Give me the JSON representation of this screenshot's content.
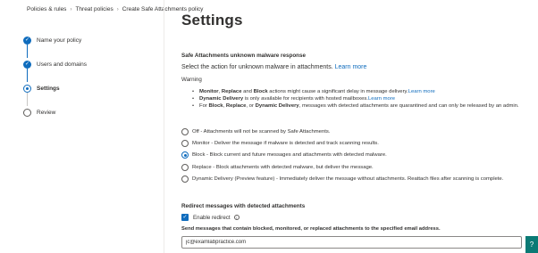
{
  "breadcrumb": [
    "Policies & rules",
    "Threat policies",
    "Create Safe Attachments policy"
  ],
  "wizard": {
    "steps": [
      {
        "label": "Name your policy",
        "state": "done"
      },
      {
        "label": "Users and domains",
        "state": "done"
      },
      {
        "label": "Settings",
        "state": "current"
      },
      {
        "label": "Review",
        "state": "todo"
      }
    ]
  },
  "page": {
    "title": "Settings",
    "unknown_section_title": "Safe Attachments unknown malware response",
    "unknown_section_desc": "Select the action for unknown malware in attachments.",
    "learn_more": "Learn more",
    "warning_label": "Warning",
    "warnings": [
      {
        "bold1": "Monitor",
        "t1": ", ",
        "bold2": "Replace",
        "t2": " and ",
        "bold3": "Block",
        "t3": " actions might cause a significant delay in message delivery.",
        "link": "Learn more"
      },
      {
        "bold1": "Dynamic Delivery",
        "t1": " is only available for recipients with hosted mailboxes.",
        "bold2": "",
        "t2": "",
        "bold3": "",
        "t3": "",
        "link": "Learn more"
      },
      {
        "bold1": "",
        "t1": "For ",
        "bold2": "Block",
        "t2": ", ",
        "bold3": "Replace",
        "t3": ", or ",
        "bold4": "Dynamic Delivery",
        "t4": ", messages with detected attachments are quarantined and can only be released by an admin.",
        "link": ""
      }
    ],
    "options": [
      {
        "label": "Off - Attachments will not be scanned by Safe Attachments.",
        "selected": false
      },
      {
        "label": "Monitor - Deliver the message if malware is detected and track scanning results.",
        "selected": false
      },
      {
        "label": "Block - Block current and future messages and attachments with detected malware.",
        "selected": true
      },
      {
        "label": "Replace - Block attachments with detected malware, but deliver the message.",
        "selected": false
      },
      {
        "label": "Dynamic Delivery (Preview feature) - Immediately deliver the message without attachments. Reattach files after scanning is complete.",
        "selected": false
      }
    ],
    "redirect_section_title": "Redirect messages with detected attachments",
    "enable_redirect_label": "Enable redirect",
    "enable_redirect_checked": true,
    "email_label": "Send messages that contain blocked, monitored, or replaced attachments to the specified email address.",
    "email_value": "jc@examlabpractice.com"
  },
  "help_button_icon": "help-icon",
  "colors": {
    "accent": "#0f6cbd",
    "help": "#0b7a75"
  }
}
